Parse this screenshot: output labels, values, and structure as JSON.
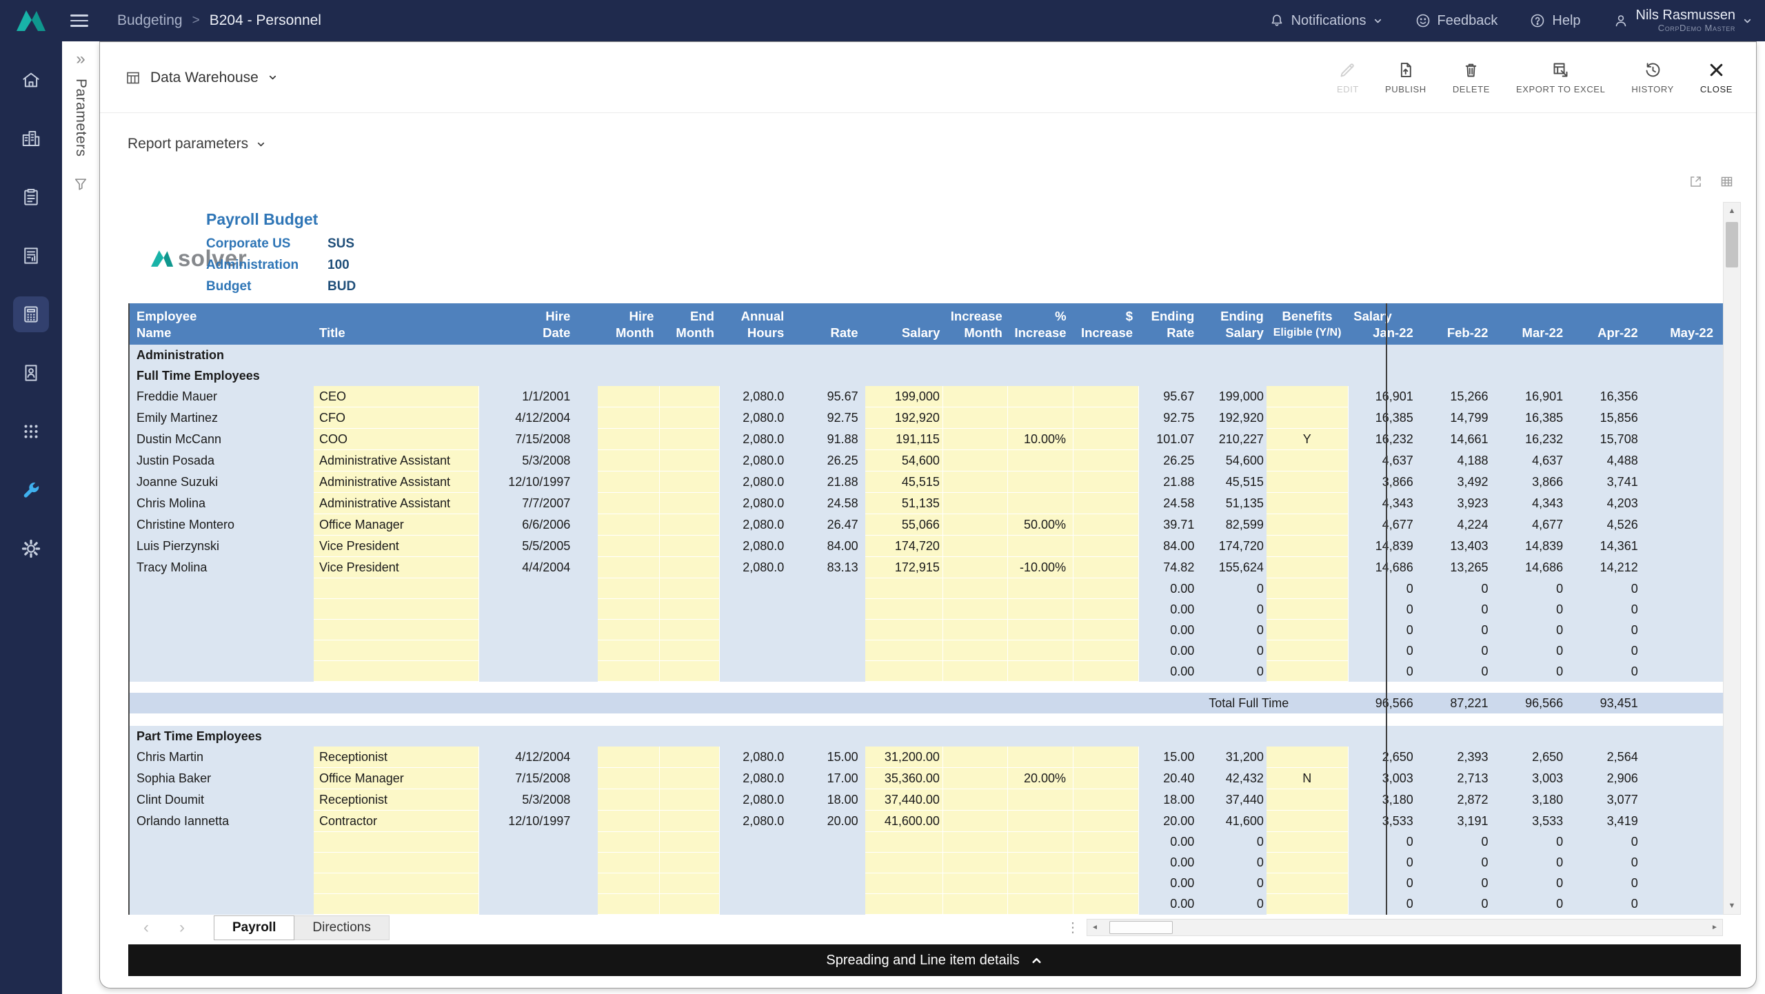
{
  "topbar": {
    "breadcrumb": {
      "section": "Budgeting",
      "separator": ">",
      "page": "B204 - Personnel"
    },
    "notifications_label": "Notifications",
    "feedback_label": "Feedback",
    "help_label": "Help",
    "user": {
      "name": "Nils Rasmussen",
      "org": "CorpDemo Master"
    }
  },
  "sidebar": {
    "icons": [
      "home-icon",
      "buildings-icon",
      "tasks-icon",
      "report-icon",
      "calculator-icon",
      "people-report-icon",
      "modules-icon",
      "tools-icon",
      "settings-icon"
    ],
    "active_icon": "calculator-icon"
  },
  "parameters_panel": {
    "label": "Parameters"
  },
  "toolbar": {
    "view_selector": {
      "label": "Data Warehouse"
    },
    "actions": [
      {
        "label": "EDIT",
        "disabled": true
      },
      {
        "label": "PUBLISH"
      },
      {
        "label": "DELETE"
      },
      {
        "label": "EXPORT TO EXCEL"
      },
      {
        "label": "HISTORY"
      },
      {
        "label": "CLOSE"
      }
    ]
  },
  "report_parameters_label": "Report parameters",
  "colors": {
    "navy": "#1f2a4d",
    "header_blue": "#4f81bd",
    "sheet_blue": "#dbe5f1",
    "input_yellow": "#fcf8c8",
    "total_band": "#ccd9ec",
    "accent_teal": "#18b3a8",
    "tools_blue": "#3fb0ee"
  },
  "sheet": {
    "logo_text": "solver",
    "title": "Payroll Budget",
    "info": [
      {
        "label": "Corporate US",
        "value": "SUS"
      },
      {
        "label": "Administration",
        "value": "100"
      },
      {
        "label": "Budget",
        "value": "BUD"
      }
    ],
    "salary_group_label": "Salary",
    "months": [
      "Jan-22",
      "Feb-22",
      "Mar-22",
      "Apr-22",
      "May-22"
    ],
    "columns": [
      {
        "l1": "Employee",
        "l2": "Name"
      },
      {
        "l1": "",
        "l2": "Title"
      },
      {
        "l1": "Hire",
        "l2": "Date"
      },
      {
        "l1": "Hire",
        "l2": "Month"
      },
      {
        "l1": "End",
        "l2": "Month"
      },
      {
        "l1": "Annual",
        "l2": "Hours"
      },
      {
        "l1": "",
        "l2": "Rate"
      },
      {
        "l1": "",
        "l2": "Salary"
      },
      {
        "l1": "Increase",
        "l2": "Month"
      },
      {
        "l1": "%",
        "l2": "Increase"
      },
      {
        "l1": "$",
        "l2": "Increase"
      },
      {
        "l1": "Ending",
        "l2": "Rate"
      },
      {
        "l1": "Ending",
        "l2": "Salary"
      },
      {
        "l1": "Benefits",
        "l2": "Eligible (Y/N)"
      }
    ],
    "empty_row_defaults": {
      "ending_rate": "0.00",
      "ending_salary": "0",
      "month": "0"
    },
    "sections": [
      {
        "type": "region",
        "label": "Administration"
      },
      {
        "type": "group",
        "label": "Full Time Employees",
        "empty_rows": 5,
        "rows": [
          {
            "name": "Freddie Mauer",
            "title": "CEO",
            "hire_date": "1/1/2001",
            "annual_hours": "2,080.0",
            "rate": "95.67",
            "salary": "199,000",
            "pct_increase": "",
            "ending_rate": "95.67",
            "ending_salary": "199,000",
            "benefits": "",
            "months": [
              "16,901",
              "15,266",
              "16,901",
              "16,356"
            ]
          },
          {
            "name": "Emily Martinez",
            "title": "CFO",
            "hire_date": "4/12/2004",
            "annual_hours": "2,080.0",
            "rate": "92.75",
            "salary": "192,920",
            "pct_increase": "",
            "ending_rate": "92.75",
            "ending_salary": "192,920",
            "benefits": "",
            "months": [
              "16,385",
              "14,799",
              "16,385",
              "15,856"
            ]
          },
          {
            "name": "Dustin McCann",
            "title": "COO",
            "hire_date": "7/15/2008",
            "annual_hours": "2,080.0",
            "rate": "91.88",
            "salary": "191,115",
            "pct_increase": "10.00%",
            "ending_rate": "101.07",
            "ending_salary": "210,227",
            "benefits": "Y",
            "months": [
              "16,232",
              "14,661",
              "16,232",
              "15,708"
            ]
          },
          {
            "name": "Justin Posada",
            "title": "Administrative Assistant",
            "hire_date": "5/3/2008",
            "annual_hours": "2,080.0",
            "rate": "26.25",
            "salary": "54,600",
            "pct_increase": "",
            "ending_rate": "26.25",
            "ending_salary": "54,600",
            "benefits": "",
            "months": [
              "4,637",
              "4,188",
              "4,637",
              "4,488"
            ]
          },
          {
            "name": "Joanne Suzuki",
            "title": "Administrative Assistant",
            "hire_date": "12/10/1997",
            "annual_hours": "2,080.0",
            "rate": "21.88",
            "salary": "45,515",
            "pct_increase": "",
            "ending_rate": "21.88",
            "ending_salary": "45,515",
            "benefits": "",
            "months": [
              "3,866",
              "3,492",
              "3,866",
              "3,741"
            ]
          },
          {
            "name": "Chris Molina",
            "title": "Administrative Assistant",
            "hire_date": "7/7/2007",
            "annual_hours": "2,080.0",
            "rate": "24.58",
            "salary": "51,135",
            "pct_increase": "",
            "ending_rate": "24.58",
            "ending_salary": "51,135",
            "benefits": "",
            "months": [
              "4,343",
              "3,923",
              "4,343",
              "4,203"
            ]
          },
          {
            "name": "Christine Montero",
            "title": "Office Manager",
            "hire_date": "6/6/2006",
            "annual_hours": "2,080.0",
            "rate": "26.47",
            "salary": "55,066",
            "pct_increase": "50.00%",
            "ending_rate": "39.71",
            "ending_salary": "82,599",
            "benefits": "",
            "months": [
              "4,677",
              "4,224",
              "4,677",
              "4,526"
            ]
          },
          {
            "name": "Luis Pierzynski",
            "title": "Vice President",
            "hire_date": "5/5/2005",
            "annual_hours": "2,080.0",
            "rate": "84.00",
            "salary": "174,720",
            "pct_increase": "",
            "ending_rate": "84.00",
            "ending_salary": "174,720",
            "benefits": "",
            "months": [
              "14,839",
              "13,403",
              "14,839",
              "14,361"
            ]
          },
          {
            "name": "Tracy Molina",
            "title": "Vice President",
            "hire_date": "4/4/2004",
            "annual_hours": "2,080.0",
            "rate": "83.13",
            "salary": "172,915",
            "pct_increase": "-10.00%",
            "ending_rate": "74.82",
            "ending_salary": "155,624",
            "benefits": "",
            "months": [
              "14,686",
              "13,265",
              "14,686",
              "14,212"
            ]
          }
        ],
        "total": {
          "label": "Total Full Time",
          "months": [
            "96,566",
            "87,221",
            "96,566",
            "93,451"
          ]
        }
      },
      {
        "type": "group",
        "label": "Part Time Employees",
        "empty_rows": 5,
        "rows": [
          {
            "name": "Chris Martin",
            "title": "Receptionist",
            "hire_date": "4/12/2004",
            "annual_hours": "2,080.0",
            "rate": "15.00",
            "salary": "31,200.00",
            "pct_increase": "",
            "ending_rate": "15.00",
            "ending_salary": "31,200",
            "benefits": "",
            "months": [
              "2,650",
              "2,393",
              "2,650",
              "2,564"
            ]
          },
          {
            "name": "Sophia Baker",
            "title": "Office Manager",
            "hire_date": "7/15/2008",
            "annual_hours": "2,080.0",
            "rate": "17.00",
            "salary": "35,360.00",
            "pct_increase": "20.00%",
            "ending_rate": "20.40",
            "ending_salary": "42,432",
            "benefits": "N",
            "months": [
              "3,003",
              "2,713",
              "3,003",
              "2,906"
            ]
          },
          {
            "name": "Clint Doumit",
            "title": "Receptionist",
            "hire_date": "5/3/2008",
            "annual_hours": "2,080.0",
            "rate": "18.00",
            "salary": "37,440.00",
            "pct_increase": "",
            "ending_rate": "18.00",
            "ending_salary": "37,440",
            "benefits": "",
            "months": [
              "3,180",
              "2,872",
              "3,180",
              "3,077"
            ]
          },
          {
            "name": "Orlando Iannetta",
            "title": "Contractor",
            "hire_date": "12/10/1997",
            "annual_hours": "2,080.0",
            "rate": "20.00",
            "salary": "41,600.00",
            "pct_increase": "",
            "ending_rate": "20.00",
            "ending_salary": "41,600",
            "benefits": "",
            "months": [
              "3,533",
              "3,191",
              "3,533",
              "3,419"
            ]
          }
        ]
      }
    ]
  },
  "tabs": {
    "items": [
      "Payroll",
      "Directions"
    ],
    "active": "Payroll"
  },
  "footer_bar": {
    "label": "Spreading and Line item details"
  }
}
